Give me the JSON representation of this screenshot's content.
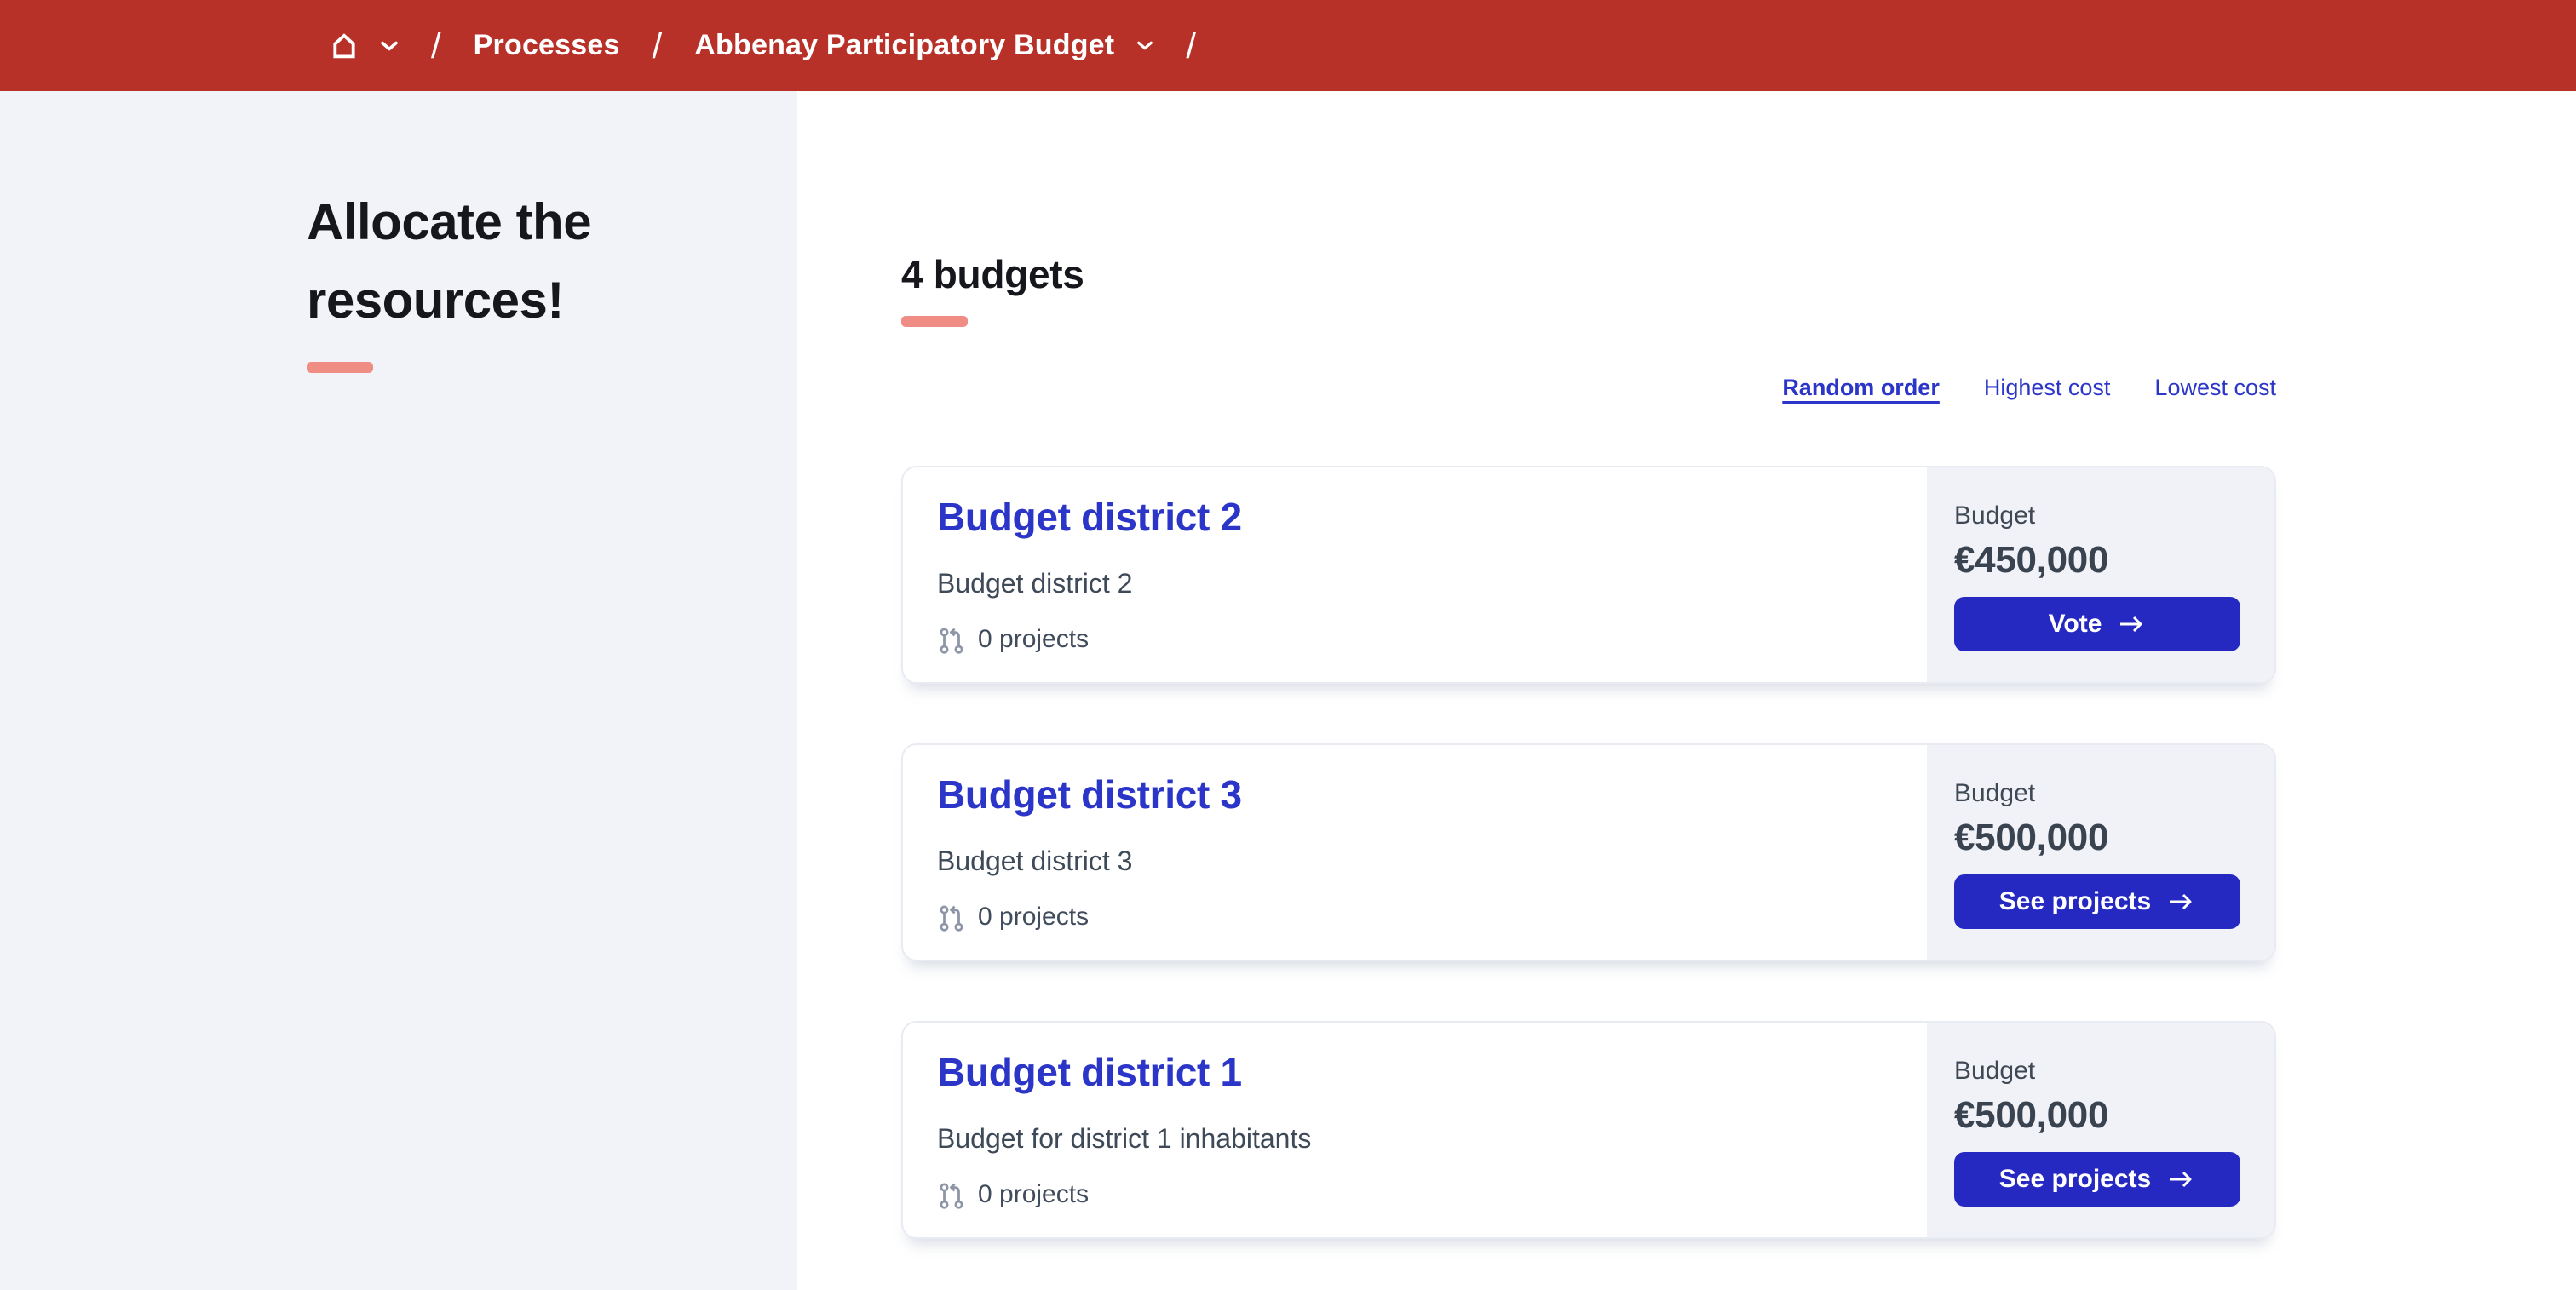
{
  "colors": {
    "topbar_red": "#b83129",
    "accent_salmon": "#ef8c84",
    "link_blue": "#2b35c8",
    "button_blue": "#2629c1",
    "sidebar_gray": "#f1f3f8",
    "panel_gray": "#f1f2f7"
  },
  "breadcrumb": {
    "separator": "/",
    "home_icon": "home-icon",
    "home_chevron_icon": "chevron-down-icon",
    "items": [
      {
        "label": "Processes",
        "has_chevron": false
      },
      {
        "label": "Abbenay Participatory Budget",
        "has_chevron": true
      }
    ]
  },
  "sidebar": {
    "title": "Allocate the resources!"
  },
  "main": {
    "heading": "4 budgets",
    "sort_options": [
      {
        "label": "Random order",
        "active": true
      },
      {
        "label": "Highest cost",
        "active": false
      },
      {
        "label": "Lowest cost",
        "active": false
      }
    ],
    "cards": [
      {
        "title": "Budget district 2",
        "description": "Budget district 2",
        "projects_icon": "git-pull-request-icon",
        "projects": "0 projects",
        "budget_label": "Budget",
        "amount": "€450,000",
        "button_label": "Vote",
        "button_icon": "arrow-right-icon"
      },
      {
        "title": "Budget district 3",
        "description": "Budget district 3",
        "projects_icon": "git-pull-request-icon",
        "projects": "0 projects",
        "budget_label": "Budget",
        "amount": "€500,000",
        "button_label": "See projects",
        "button_icon": "arrow-right-icon"
      },
      {
        "title": "Budget district 1",
        "description": "Budget for district 1 inhabitants",
        "projects_icon": "git-pull-request-icon",
        "projects": "0 projects",
        "budget_label": "Budget",
        "amount": "€500,000",
        "button_label": "See projects",
        "button_icon": "arrow-right-icon"
      }
    ]
  }
}
